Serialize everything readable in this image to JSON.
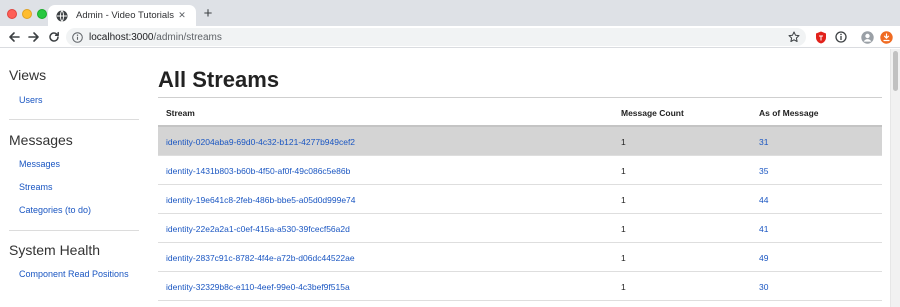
{
  "browser": {
    "tab_title": "Admin - Video Tutorials",
    "tab_close": "✕",
    "new_tab": "+",
    "url_host": "localhost:3000",
    "url_path": "/admin/streams"
  },
  "sidebar": {
    "sections": [
      {
        "heading": "Views",
        "links": [
          "Users"
        ]
      },
      {
        "heading": "Messages",
        "links": [
          "Messages",
          "Streams",
          "Categories (to do)"
        ]
      },
      {
        "heading": "System Health",
        "links": [
          "Component Read Positions"
        ]
      }
    ]
  },
  "main": {
    "title": "All Streams",
    "columns": [
      "Stream",
      "Message Count",
      "As of Message"
    ],
    "rows": [
      {
        "stream": "identity-0204aba9-69d0-4c32-b121-4277b949cef2",
        "count": "1",
        "as_of": "31",
        "highlighted": true
      },
      {
        "stream": "identity-1431b803-b60b-4f50-af0f-49c086c5e86b",
        "count": "1",
        "as_of": "35"
      },
      {
        "stream": "identity-19e641c8-2feb-486b-bbe5-a05d0d999e74",
        "count": "1",
        "as_of": "44"
      },
      {
        "stream": "identity-22e2a2a1-c0ef-415a-a530-39fcecf56a2d",
        "count": "1",
        "as_of": "41"
      },
      {
        "stream": "identity-2837c91c-8782-4f4e-a72b-d06dc44522ae",
        "count": "1",
        "as_of": "49"
      },
      {
        "stream": "identity-32329b8c-e110-4eef-99e0-4c3bef9f515a",
        "count": "1",
        "as_of": "30"
      }
    ]
  },
  "colors": {
    "link": "#1a56c2",
    "row_highlight": "#d4d4d4",
    "chrome_bg": "#dee1e6"
  }
}
